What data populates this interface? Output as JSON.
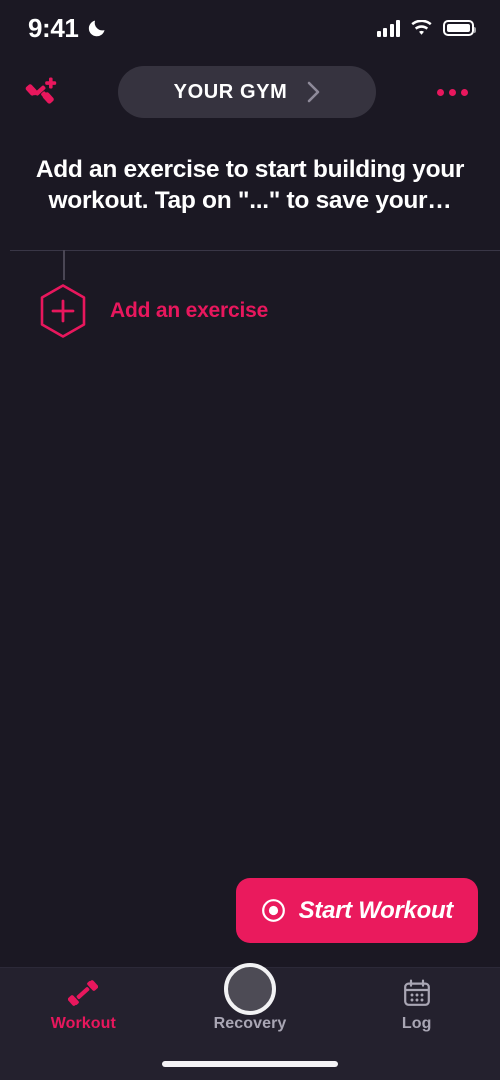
{
  "theme": {
    "background": "#1b1823",
    "accent": "#e8175d",
    "tabbar_background": "#24212e",
    "pill_background": "#36333f",
    "muted_text": "#a9a6b4",
    "divider": "#393646"
  },
  "status_bar": {
    "time": "9:41",
    "dnd_icon": "moon-icon",
    "signal_icon": "cellular-signal-icon",
    "wifi_icon": "wifi-icon",
    "battery_icon": "battery-icon"
  },
  "nav_bar": {
    "left_icon": "add-dumbbell-icon",
    "gym_label": "YOUR GYM",
    "gym_chevron": "chevron-right-icon",
    "overflow_icon": "more-options-icon"
  },
  "headline": {
    "text": "Add an exercise to start building your workout. Tap on \"...\" to save your…"
  },
  "add_exercise": {
    "icon": "hexagon-plus-icon",
    "label": "Add an exercise"
  },
  "loading": {
    "indicator": "circle-loading-indicator"
  },
  "primary_action": {
    "icon": "record-circle-icon",
    "label": "Start Workout"
  },
  "tab_bar": {
    "tabs": [
      {
        "label": "Workout",
        "icon": "dumbbell-icon",
        "active": true
      },
      {
        "label": "Recovery",
        "icon": "clock-restore-icon",
        "active": false
      },
      {
        "label": "Log",
        "icon": "calendar-icon",
        "active": false
      }
    ]
  },
  "home_indicator": "home-indicator"
}
